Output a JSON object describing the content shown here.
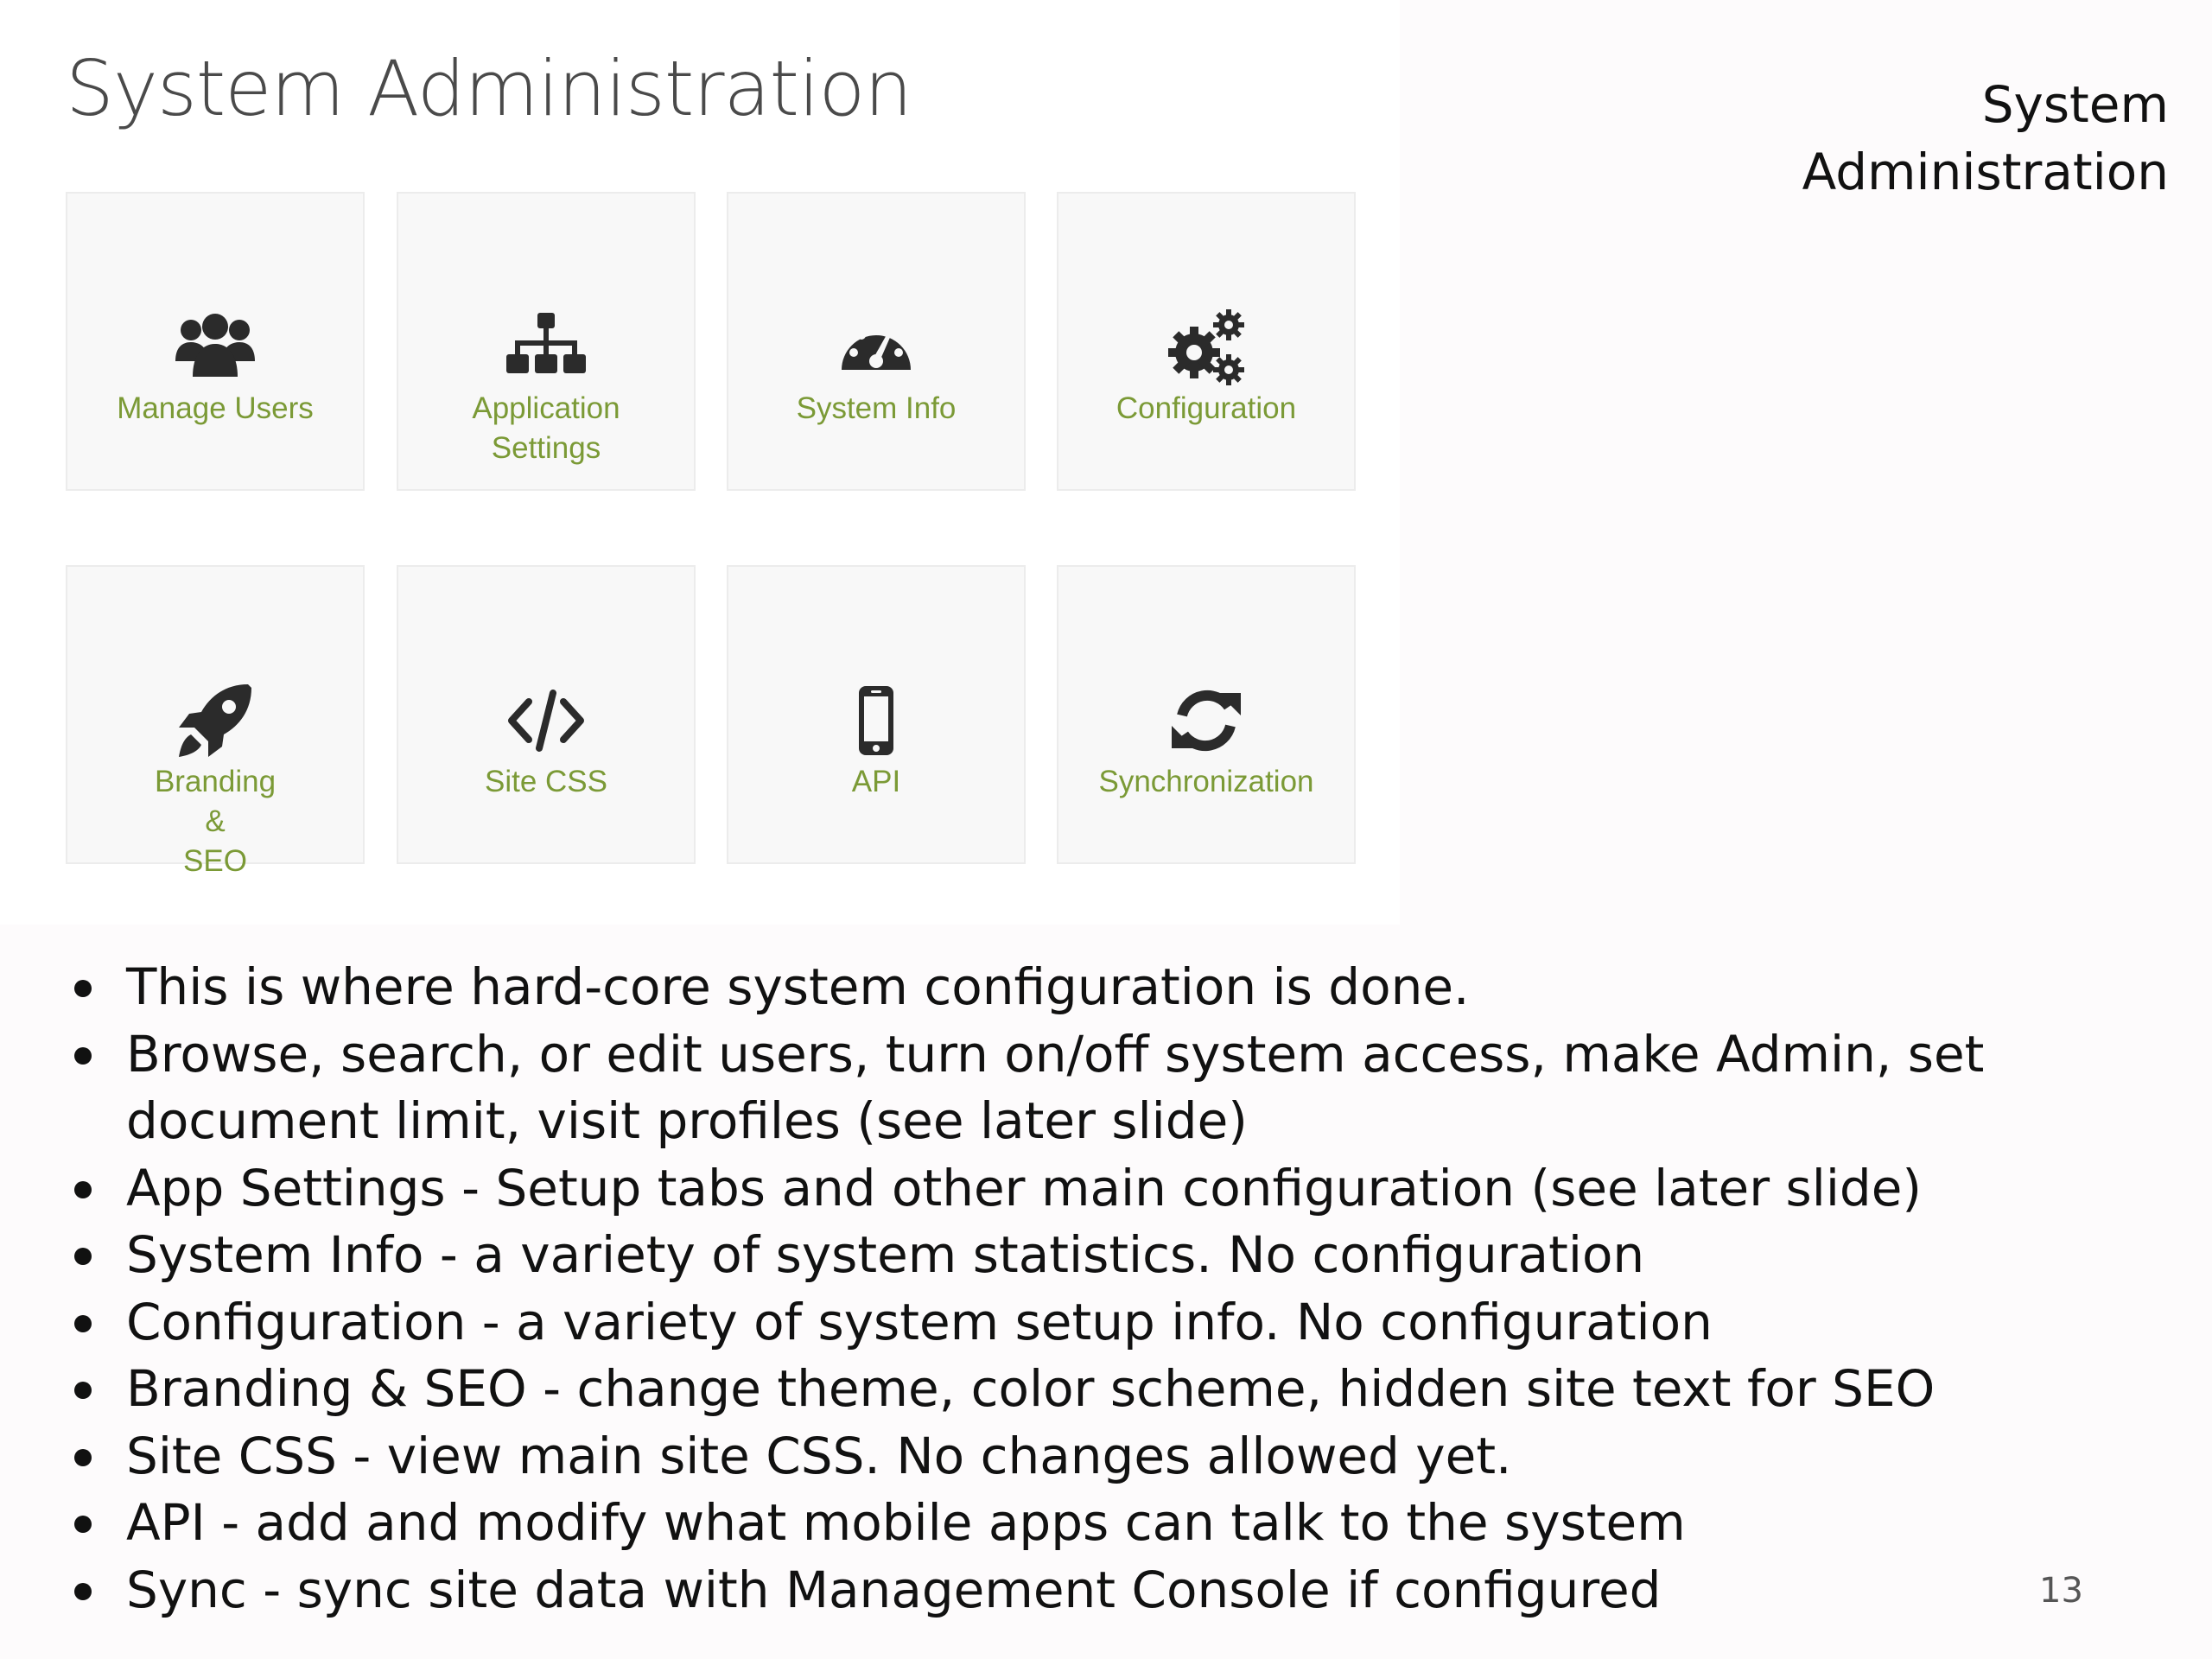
{
  "slide": {
    "heading": "System Administration",
    "page_number": "13"
  },
  "screenshot": {
    "title": "System Administration",
    "label_color": "#7b9a36",
    "tiles": [
      {
        "label": "Manage Users",
        "icon": "users-icon"
      },
      {
        "label": "Application Settings",
        "icon": "sitemap-icon"
      },
      {
        "label": "System Info",
        "icon": "dashboard-icon"
      },
      {
        "label": "Configuration",
        "icon": "gears-icon"
      },
      {
        "label": "Branding & SEO",
        "icon": "rocket-icon"
      },
      {
        "label": "Site CSS",
        "icon": "code-icon"
      },
      {
        "label": "API",
        "icon": "mobile-icon"
      },
      {
        "label": "Synchronization",
        "icon": "refresh-icon"
      }
    ]
  },
  "bullets": [
    "This is where hard-core system configuration is done.",
    "Browse, search, or edit users, turn on/off system access, make Admin, set document limit, visit profiles (see later slide)",
    "App Settings - Setup tabs and other main configuration (see later slide)",
    "System Info - a variety of system statistics. No configuration",
    "Configuration - a variety of system setup info. No configuration",
    "Branding & SEO - change theme, color scheme, hidden site text for SEO",
    "Site CSS - view main site CSS. No changes allowed yet.",
    "API - add and modify what mobile apps can talk to the system",
    "Sync - sync site data with Management Console if configured"
  ]
}
